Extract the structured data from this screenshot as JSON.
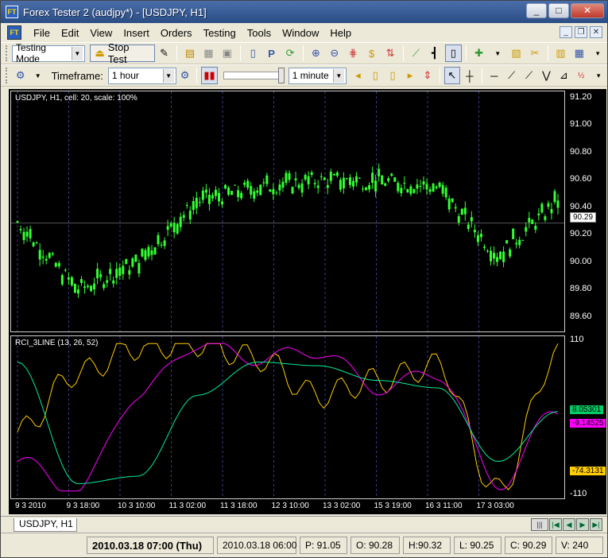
{
  "window": {
    "title": "Forex Tester 2  (audjpy*) - [USDJPY, H1]",
    "app_icon": "FT"
  },
  "menu": [
    "File",
    "Edit",
    "View",
    "Insert",
    "Orders",
    "Testing",
    "Tools",
    "Window",
    "Help"
  ],
  "toolbar": {
    "mode_select": "Testing Mode",
    "stop_test_label": "Stop Test",
    "timeframe_label": "Timeframe:",
    "timeframe_value": "1 hour",
    "speed_value": "1 minute"
  },
  "chart": {
    "main_label": "USDJPY, H1, cell: 20, scale: 100%",
    "indicator_label": "RCI_3LINE (13, 26, 52)",
    "price_axis": [
      "91.20",
      "91.00",
      "90.80",
      "90.60",
      "90.40",
      "90.20",
      "90.00",
      "89.80",
      "89.60"
    ],
    "price_tag": "90.29",
    "ind_axis_top": "110",
    "ind_axis_bottom": "-110",
    "ind_tags": [
      {
        "value": "8.05301",
        "color": "#00cc66"
      },
      {
        "value": "-9.14525",
        "color": "#ff00ff"
      },
      {
        "value": "-74.3131",
        "color": "#ffcc00"
      }
    ],
    "time_labels": [
      "9 3 2010",
      "9 3 18:00",
      "10 3 10:00",
      "11 3 02:00",
      "11 3 18:00",
      "12 3 10:00",
      "13 3 02:00",
      "15 3 19:00",
      "16 3 11:00",
      "17 3 03:00"
    ],
    "colors": {
      "candle": "#33ff33",
      "grid": "#3a3a8a",
      "rci_short": "#ffcc00",
      "rci_mid": "#ff00ff",
      "rci_long": "#00ee99"
    }
  },
  "chart_data": {
    "type": "line",
    "title": "USDJPY, H1, cell: 20, scale: 100%",
    "xlabel": "",
    "ylabel": "",
    "ylim": [
      89.5,
      91.25
    ],
    "x": [
      "9 3 2010",
      "9 3 18:00",
      "10 3 10:00",
      "11 3 02:00",
      "11 3 18:00",
      "12 3 10:00",
      "13 3 02:00",
      "15 3 19:00",
      "16 3 11:00",
      "17 3 03:00"
    ],
    "series": [
      {
        "name": "",
        "values": [
          90.3,
          89.8,
          90.0,
          90.45,
          90.55,
          90.6,
          90.6,
          90.55,
          90.05,
          90.45
        ]
      }
    ],
    "indicator": {
      "ylim": [
        -110,
        110
      ],
      "series": [
        {
          "name": "",
          "values": [
            -20,
            60,
            95,
            100,
            80,
            30,
            50,
            70,
            -100,
            85
          ]
        },
        {
          "name": "",
          "values": [
            -60,
            -100,
            30,
            100,
            80,
            90,
            40,
            60,
            -90,
            10
          ]
        },
        {
          "name": "",
          "values": [
            75,
            -90,
            -80,
            30,
            75,
            70,
            50,
            40,
            -60,
            8
          ]
        }
      ]
    },
    "grid": true
  },
  "tabs": [
    "USDJPY, H1"
  ],
  "status": {
    "datetime": "2010.03.18 07:00 (Thu)",
    "bar_time": "2010.03.18 06:00",
    "p": "P: 91.05",
    "o": "O: 90.28",
    "h": "H:90.32",
    "l": "L: 90.25",
    "c": "C: 90.29",
    "v": "V: 240"
  }
}
